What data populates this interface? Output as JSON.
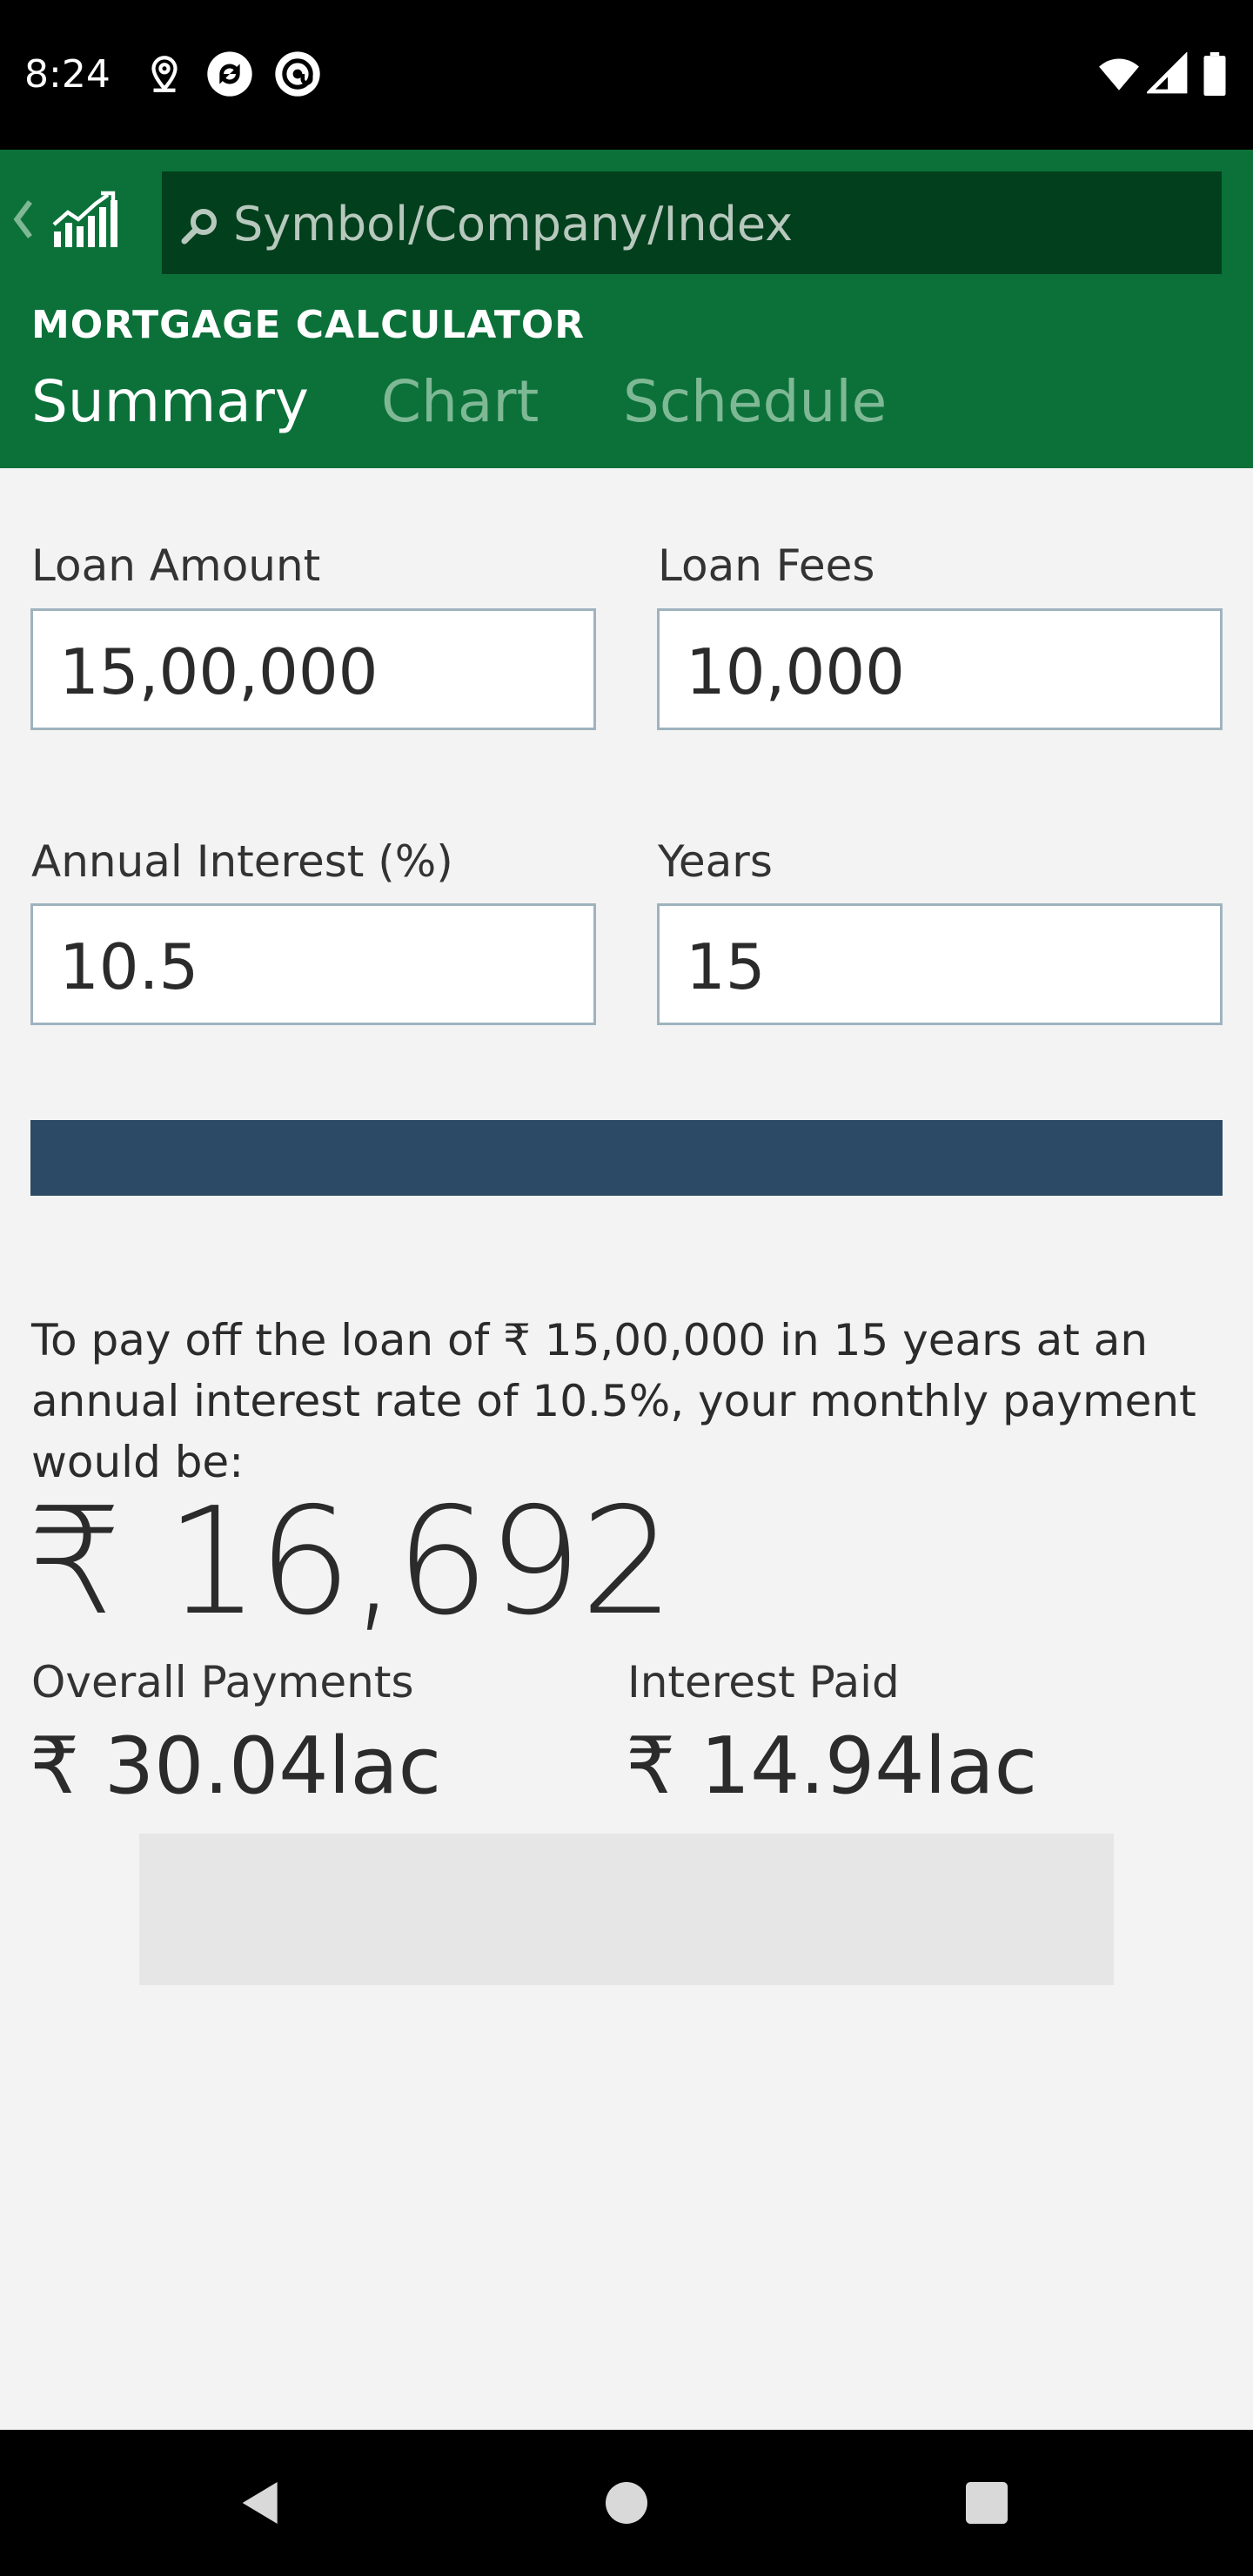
{
  "status_bar": {
    "time": "8:24",
    "icons": [
      "location-icon",
      "sync-icon",
      "at-icon",
      "wifi-icon",
      "signal-icon",
      "battery-icon"
    ]
  },
  "header": {
    "search_placeholder": "Symbol/Company/Index",
    "title": "MORTGAGE CALCULATOR",
    "tabs": [
      {
        "label": "Summary",
        "selected": true
      },
      {
        "label": "Chart",
        "selected": false
      },
      {
        "label": "Schedule",
        "selected": false
      }
    ],
    "colors": {
      "header_bg": "#0b7139",
      "search_bg": "#023f1d",
      "active_tab": "#ffffff",
      "inactive_tab": "#7eb895"
    }
  },
  "form": {
    "loan_amount": {
      "label": "Loan Amount",
      "value": "15,00,000"
    },
    "loan_fees": {
      "label": "Loan Fees",
      "value": "10,000"
    },
    "annual_interest": {
      "label": "Annual Interest (%)",
      "value": "10.5"
    },
    "years": {
      "label": "Years",
      "value": "15"
    }
  },
  "calculate_bar_color": "#2c4a66",
  "result": {
    "description": "To pay off the loan of ₹ 15,00,000 in 15 years at an annual interest rate of 10.5%, your monthly payment would be:",
    "monthly_payment": "₹ 16,692",
    "overall_payments": {
      "label": "Overall Payments",
      "value": "₹ 30.04lac"
    },
    "interest_paid": {
      "label": "Interest Paid",
      "value": "₹ 14.94lac"
    }
  },
  "nav_bar": {
    "buttons": [
      "back-icon",
      "home-icon",
      "recents-icon"
    ]
  }
}
